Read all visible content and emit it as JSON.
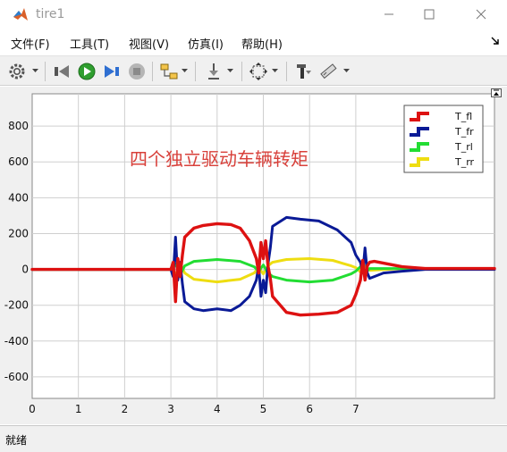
{
  "window": {
    "title": "tire1"
  },
  "menu": {
    "items": [
      "文件(F)",
      "工具(T)",
      "视图(V)",
      "仿真(I)",
      "帮助(H)"
    ]
  },
  "toolbar": {
    "icons": [
      "gear-icon",
      "step-back-icon",
      "run-icon",
      "step-forward-icon",
      "stop-icon",
      "highlight-block-icon",
      "signal-selector-icon",
      "zoom-fit-icon",
      "cursor-measure-icon",
      "style-icon"
    ]
  },
  "status": {
    "text": "就绪"
  },
  "colors": {
    "T_fl": "#dd1111",
    "T_fr": "#0a1a96",
    "T_rl": "#22dd33",
    "T_rr": "#eedd11"
  },
  "chart_data": {
    "type": "line",
    "title": "",
    "annotation": "四个独立驱动车辆转矩",
    "xlabel": "",
    "ylabel": "",
    "xlim": [
      0,
      10
    ],
    "ylim": [
      -720,
      980
    ],
    "xticks": [
      "0",
      "1",
      "2",
      "3",
      "4",
      "5",
      "6",
      "7"
    ],
    "yticks": [
      "-600",
      "-400",
      "-200",
      "0",
      "200",
      "400",
      "600",
      "800"
    ],
    "grid": true,
    "legend_position": "top-right",
    "series": [
      {
        "name": "T_fl",
        "x": [
          0,
          3.0,
          3.05,
          3.1,
          3.15,
          3.2,
          3.25,
          3.3,
          3.5,
          3.7,
          4.0,
          4.3,
          4.5,
          4.7,
          4.85,
          4.9,
          4.95,
          5.0,
          5.05,
          5.1,
          5.15,
          5.2,
          5.5,
          5.8,
          6.2,
          6.6,
          6.9,
          7.0,
          7.1,
          7.15,
          7.2,
          7.25,
          7.3,
          7.4,
          7.6,
          8.0,
          8.5,
          10
        ],
        "y": [
          0,
          0,
          40,
          -180,
          60,
          -40,
          80,
          180,
          230,
          245,
          255,
          250,
          230,
          160,
          60,
          -20,
          150,
          60,
          160,
          20,
          -50,
          -150,
          -240,
          -255,
          -250,
          -240,
          -200,
          -140,
          -60,
          50,
          -60,
          20,
          40,
          45,
          35,
          15,
          5,
          5
        ]
      },
      {
        "name": "T_fr",
        "x": [
          0,
          3.0,
          3.05,
          3.1,
          3.15,
          3.2,
          3.25,
          3.3,
          3.5,
          3.7,
          4.0,
          4.3,
          4.5,
          4.7,
          4.85,
          4.9,
          4.95,
          5.0,
          5.05,
          5.1,
          5.15,
          5.2,
          5.5,
          5.8,
          6.2,
          6.6,
          6.9,
          7.0,
          7.1,
          7.15,
          7.2,
          7.25,
          7.3,
          7.4,
          7.6,
          8.0,
          8.5,
          10
        ],
        "y": [
          0,
          0,
          -40,
          180,
          -60,
          40,
          -80,
          -180,
          -220,
          -230,
          -220,
          -230,
          -200,
          -150,
          -60,
          20,
          -150,
          -60,
          -130,
          30,
          120,
          240,
          290,
          280,
          270,
          220,
          150,
          80,
          40,
          -20,
          120,
          -20,
          -50,
          -40,
          -20,
          -10,
          0,
          0
        ]
      },
      {
        "name": "T_rl",
        "x": [
          0,
          3.0,
          3.1,
          3.2,
          3.3,
          3.5,
          4.0,
          4.5,
          4.8,
          4.9,
          5.0,
          5.1,
          5.2,
          5.5,
          6.0,
          6.5,
          6.9,
          7.0,
          7.1,
          7.2,
          7.3,
          8.0,
          10
        ],
        "y": [
          0,
          0,
          30,
          -30,
          20,
          45,
          55,
          45,
          15,
          -10,
          25,
          -20,
          -40,
          -60,
          -70,
          -60,
          -25,
          -10,
          15,
          -20,
          5,
          5,
          5
        ]
      },
      {
        "name": "T_rr",
        "x": [
          0,
          3.0,
          3.1,
          3.2,
          3.3,
          3.5,
          4.0,
          4.5,
          4.8,
          4.9,
          5.0,
          5.1,
          5.2,
          5.5,
          6.0,
          6.5,
          6.9,
          7.0,
          7.1,
          7.2,
          7.3,
          8.0,
          10
        ],
        "y": [
          0,
          0,
          -30,
          30,
          -20,
          -55,
          -70,
          -55,
          -20,
          10,
          -25,
          20,
          40,
          55,
          60,
          50,
          20,
          10,
          -15,
          20,
          -5,
          5,
          5
        ]
      }
    ]
  }
}
